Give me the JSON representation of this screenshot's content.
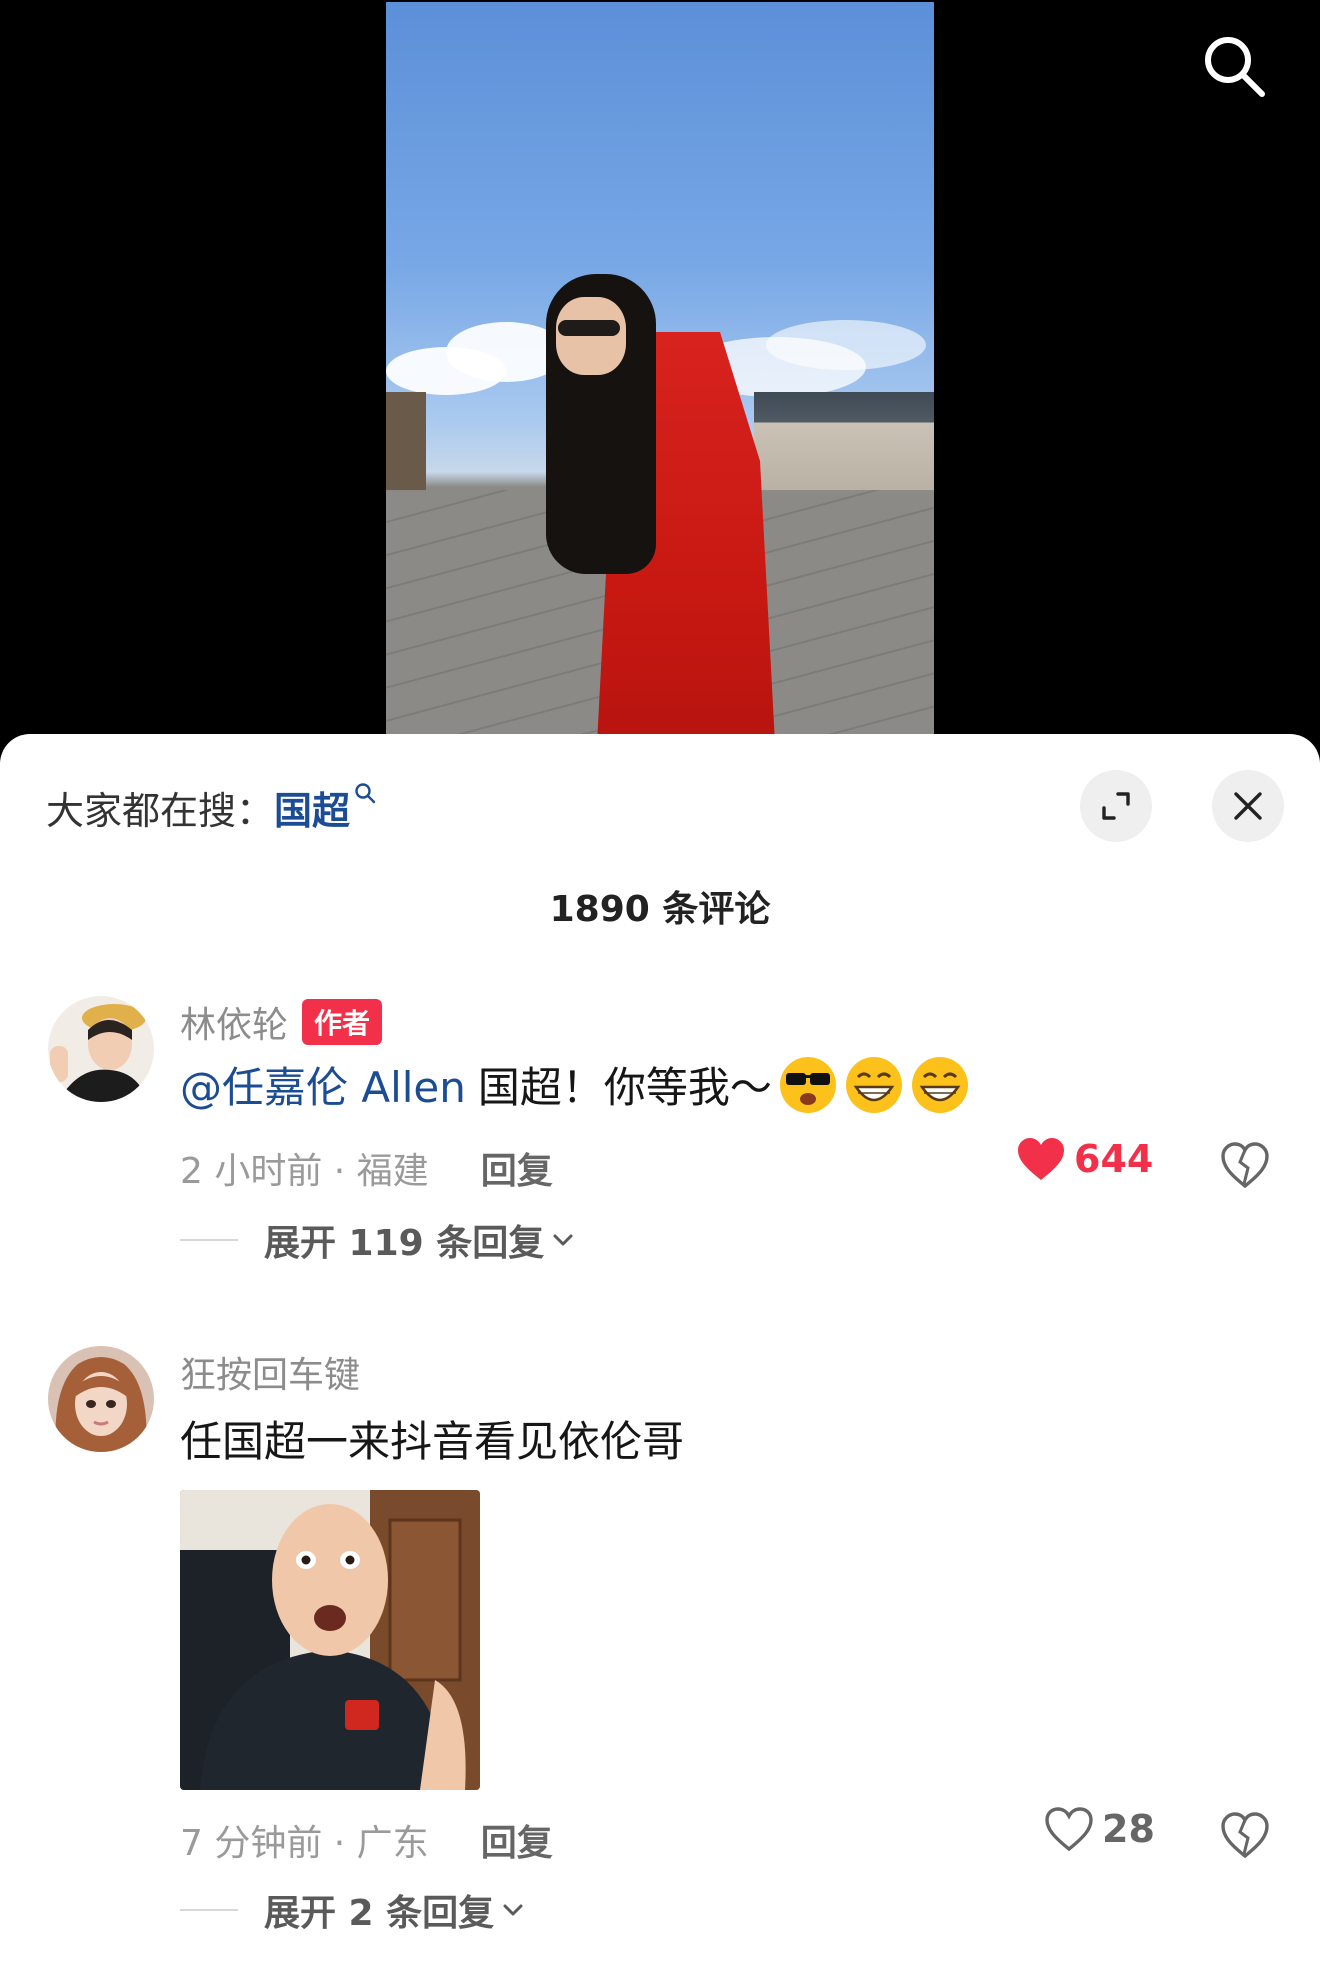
{
  "video": {
    "search_icon": "search-icon"
  },
  "sheet": {
    "trend_prefix": "大家都在搜：",
    "trend_keyword": "国超",
    "comment_count": "1890 条评论"
  },
  "comments": [
    {
      "username": "林依轮",
      "badge": "作者",
      "mention": "@任嘉伦 Allen",
      "text": "国超！你等我～",
      "emojis": [
        "sunglasses-emoji",
        "grin-emoji",
        "grin-emoji"
      ],
      "time_location": "2 小时前 · 福建",
      "reply_label": "回复",
      "likes": "644",
      "liked": true,
      "expand_label": "展开 119 条回复"
    },
    {
      "username": "狂按回车键",
      "text": "任国超一来抖音看见依伦哥",
      "time_location": "7 分钟前 · 广东",
      "reply_label": "回复",
      "likes": "28",
      "liked": false,
      "expand_label": "展开 2 条回复"
    }
  ],
  "colors": {
    "like_red": "#f2304a",
    "link_blue": "#1c4d94"
  }
}
